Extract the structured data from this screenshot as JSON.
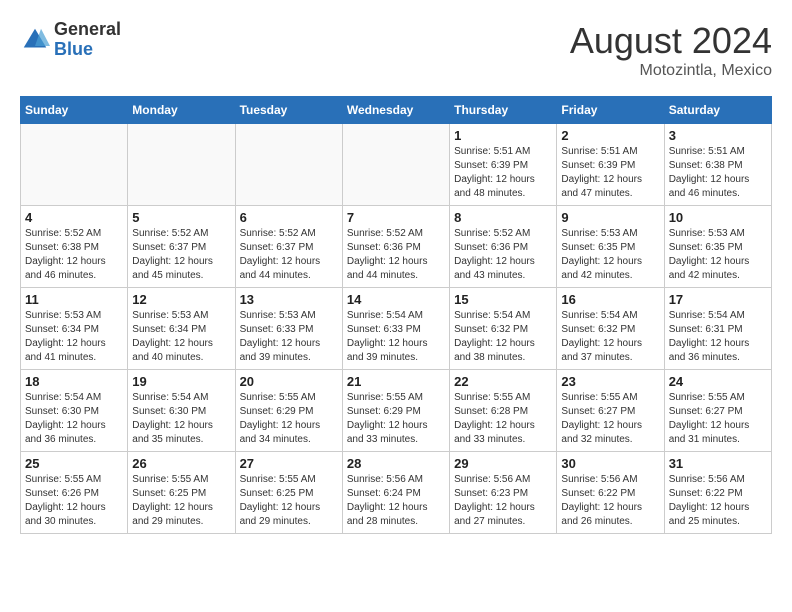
{
  "header": {
    "logo": {
      "general": "General",
      "blue": "Blue"
    },
    "month_year": "August 2024",
    "location": "Motozintla, Mexico"
  },
  "weekdays": [
    "Sunday",
    "Monday",
    "Tuesday",
    "Wednesday",
    "Thursday",
    "Friday",
    "Saturday"
  ],
  "weeks": [
    [
      {
        "day": "",
        "empty": true
      },
      {
        "day": "",
        "empty": true
      },
      {
        "day": "",
        "empty": true
      },
      {
        "day": "",
        "empty": true
      },
      {
        "day": "1",
        "sunrise": "5:51 AM",
        "sunset": "6:39 PM",
        "daylight": "12 hours and 48 minutes."
      },
      {
        "day": "2",
        "sunrise": "5:51 AM",
        "sunset": "6:39 PM",
        "daylight": "12 hours and 47 minutes."
      },
      {
        "day": "3",
        "sunrise": "5:51 AM",
        "sunset": "6:38 PM",
        "daylight": "12 hours and 46 minutes."
      }
    ],
    [
      {
        "day": "4",
        "sunrise": "5:52 AM",
        "sunset": "6:38 PM",
        "daylight": "12 hours and 46 minutes."
      },
      {
        "day": "5",
        "sunrise": "5:52 AM",
        "sunset": "6:37 PM",
        "daylight": "12 hours and 45 minutes."
      },
      {
        "day": "6",
        "sunrise": "5:52 AM",
        "sunset": "6:37 PM",
        "daylight": "12 hours and 44 minutes."
      },
      {
        "day": "7",
        "sunrise": "5:52 AM",
        "sunset": "6:36 PM",
        "daylight": "12 hours and 44 minutes."
      },
      {
        "day": "8",
        "sunrise": "5:52 AM",
        "sunset": "6:36 PM",
        "daylight": "12 hours and 43 minutes."
      },
      {
        "day": "9",
        "sunrise": "5:53 AM",
        "sunset": "6:35 PM",
        "daylight": "12 hours and 42 minutes."
      },
      {
        "day": "10",
        "sunrise": "5:53 AM",
        "sunset": "6:35 PM",
        "daylight": "12 hours and 42 minutes."
      }
    ],
    [
      {
        "day": "11",
        "sunrise": "5:53 AM",
        "sunset": "6:34 PM",
        "daylight": "12 hours and 41 minutes."
      },
      {
        "day": "12",
        "sunrise": "5:53 AM",
        "sunset": "6:34 PM",
        "daylight": "12 hours and 40 minutes."
      },
      {
        "day": "13",
        "sunrise": "5:53 AM",
        "sunset": "6:33 PM",
        "daylight": "12 hours and 39 minutes."
      },
      {
        "day": "14",
        "sunrise": "5:54 AM",
        "sunset": "6:33 PM",
        "daylight": "12 hours and 39 minutes."
      },
      {
        "day": "15",
        "sunrise": "5:54 AM",
        "sunset": "6:32 PM",
        "daylight": "12 hours and 38 minutes."
      },
      {
        "day": "16",
        "sunrise": "5:54 AM",
        "sunset": "6:32 PM",
        "daylight": "12 hours and 37 minutes."
      },
      {
        "day": "17",
        "sunrise": "5:54 AM",
        "sunset": "6:31 PM",
        "daylight": "12 hours and 36 minutes."
      }
    ],
    [
      {
        "day": "18",
        "sunrise": "5:54 AM",
        "sunset": "6:30 PM",
        "daylight": "12 hours and 36 minutes."
      },
      {
        "day": "19",
        "sunrise": "5:54 AM",
        "sunset": "6:30 PM",
        "daylight": "12 hours and 35 minutes."
      },
      {
        "day": "20",
        "sunrise": "5:55 AM",
        "sunset": "6:29 PM",
        "daylight": "12 hours and 34 minutes."
      },
      {
        "day": "21",
        "sunrise": "5:55 AM",
        "sunset": "6:29 PM",
        "daylight": "12 hours and 33 minutes."
      },
      {
        "day": "22",
        "sunrise": "5:55 AM",
        "sunset": "6:28 PM",
        "daylight": "12 hours and 33 minutes."
      },
      {
        "day": "23",
        "sunrise": "5:55 AM",
        "sunset": "6:27 PM",
        "daylight": "12 hours and 32 minutes."
      },
      {
        "day": "24",
        "sunrise": "5:55 AM",
        "sunset": "6:27 PM",
        "daylight": "12 hours and 31 minutes."
      }
    ],
    [
      {
        "day": "25",
        "sunrise": "5:55 AM",
        "sunset": "6:26 PM",
        "daylight": "12 hours and 30 minutes."
      },
      {
        "day": "26",
        "sunrise": "5:55 AM",
        "sunset": "6:25 PM",
        "daylight": "12 hours and 29 minutes."
      },
      {
        "day": "27",
        "sunrise": "5:55 AM",
        "sunset": "6:25 PM",
        "daylight": "12 hours and 29 minutes."
      },
      {
        "day": "28",
        "sunrise": "5:56 AM",
        "sunset": "6:24 PM",
        "daylight": "12 hours and 28 minutes."
      },
      {
        "day": "29",
        "sunrise": "5:56 AM",
        "sunset": "6:23 PM",
        "daylight": "12 hours and 27 minutes."
      },
      {
        "day": "30",
        "sunrise": "5:56 AM",
        "sunset": "6:22 PM",
        "daylight": "12 hours and 26 minutes."
      },
      {
        "day": "31",
        "sunrise": "5:56 AM",
        "sunset": "6:22 PM",
        "daylight": "12 hours and 25 minutes."
      }
    ]
  ]
}
